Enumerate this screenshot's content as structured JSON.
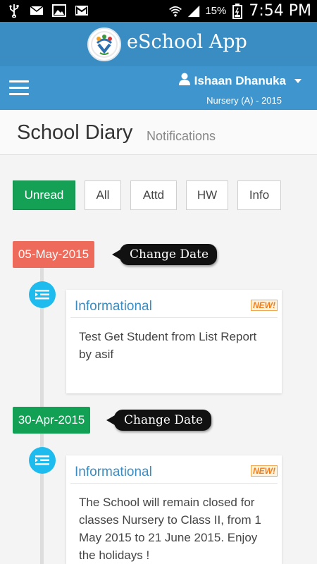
{
  "statusbar": {
    "battery_percent": "15%",
    "time": "7:54 PM"
  },
  "app": {
    "title": "eSchool App"
  },
  "user": {
    "name": "Ishaan Dhanuka",
    "class_info": "Nursery (A) - 2015"
  },
  "page": {
    "title": "School Diary",
    "subtitle": "Notifications"
  },
  "filters": [
    {
      "label": "Unread",
      "active": true
    },
    {
      "label": "All",
      "active": false
    },
    {
      "label": "Attd",
      "active": false
    },
    {
      "label": "HW",
      "active": false
    },
    {
      "label": "Info",
      "active": false
    }
  ],
  "entries": [
    {
      "date": "05-May-2015",
      "change_date_label": "Change Date",
      "type": "Informational",
      "badge": "NEW!",
      "message": "Test Get Student from List Report by asif"
    },
    {
      "date": "30-Apr-2015",
      "change_date_label": "Change Date",
      "type": "Informational",
      "badge": "NEW!",
      "message": "The School will remain closed for classes Nursery to Class II, from 1 May 2015 to 21 June 2015. Enjoy the holidays !"
    }
  ],
  "colors": {
    "appbar": "#3a8dc3",
    "navbar": "#3f96cf",
    "active_filter": "#15a155",
    "date_red": "#ee6a5a",
    "date_green": "#12a054",
    "timeline_icon": "#1ebbee"
  }
}
